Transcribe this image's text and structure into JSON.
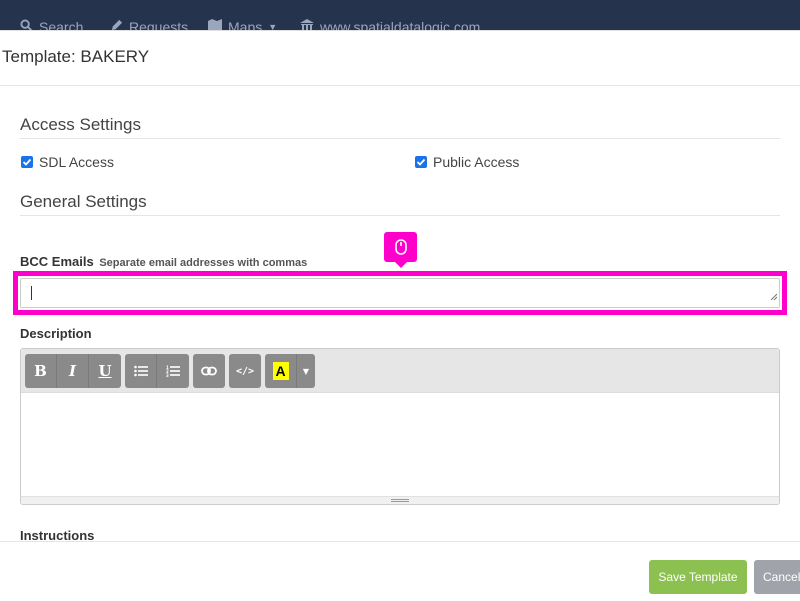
{
  "navbar": {
    "search_label": "Search",
    "requests_label": "Requests",
    "maps_label": "Maps",
    "site_label": "www.spatialdatalogic.com"
  },
  "modal": {
    "title": "Template: BAKERY"
  },
  "access_settings": {
    "title": "Access Settings",
    "sdl_access_label": "SDL Access",
    "sdl_access_checked": true,
    "public_access_label": "Public Access",
    "public_access_checked": true
  },
  "general_settings": {
    "title": "General Settings",
    "bcc_label": "BCC Emails",
    "bcc_hint": "Separate email addresses with commas",
    "bcc_value": ""
  },
  "description": {
    "label": "Description",
    "toolbar": {
      "bold": "B",
      "italic": "I",
      "underline": "U",
      "font_color_glyph": "A"
    },
    "content": ""
  },
  "instructions": {
    "label": "Instructions"
  },
  "footer": {
    "save_label": "Save Template",
    "cancel_label": "Cancel"
  },
  "colors": {
    "accent_highlight": "#ff00cc",
    "save_button": "#8cc152",
    "cancel_button": "#a0a4aa",
    "checkbox": "#1a73e8",
    "navbar": "#26334d"
  },
  "icons": {
    "cursor_badge": "mouse-icon",
    "unordered_list": "bullet-list-icon",
    "ordered_list": "numbered-list-icon",
    "link": "link-icon",
    "code": "code-view-icon",
    "dropdown": "caret-down-icon"
  }
}
